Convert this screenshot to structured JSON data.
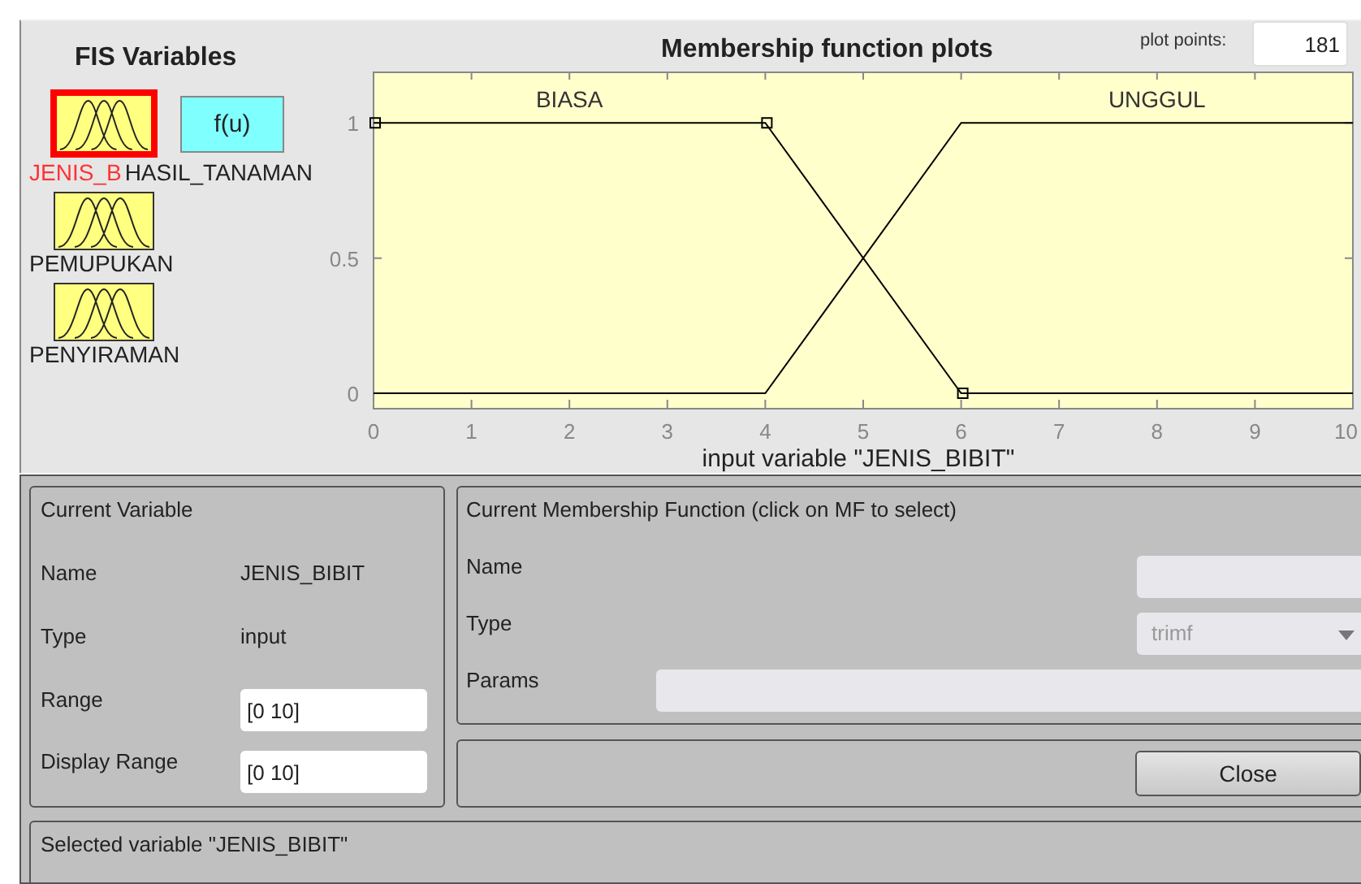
{
  "fis_variables": {
    "title": "FIS Variables",
    "items": [
      {
        "name": "JENIS_B",
        "kind": "input",
        "selected": true
      },
      {
        "name": "HASIL_TANAMAN",
        "kind": "output",
        "symbol": "f(u)",
        "selected": false
      },
      {
        "name": "PEMUPUKAN",
        "kind": "input",
        "selected": false
      },
      {
        "name": "PENYIRAMAN",
        "kind": "input",
        "selected": false
      }
    ]
  },
  "plot": {
    "title": "Membership function plots",
    "plot_points_label": "plot points:",
    "plot_points": "181",
    "chart_data": {
      "type": "line",
      "xlabel": "input variable \"JENIS_BIBIT\"",
      "x": [
        0,
        4,
        6,
        10
      ],
      "series": [
        {
          "name": "BIASA",
          "color": "#000000",
          "values": [
            1,
            1,
            0,
            0
          ]
        },
        {
          "name": "UNGGUL",
          "color": "#000000",
          "values": [
            0,
            0,
            1,
            1
          ]
        }
      ],
      "xlim": [
        0,
        10
      ],
      "ylim": [
        -0.054,
        1.19
      ],
      "xticks": [
        0,
        1,
        2,
        3,
        4,
        5,
        6,
        7,
        8,
        9,
        10
      ],
      "yticks": [
        0,
        {
          "value": 0.5,
          "label": "0.5"
        },
        1
      ]
    }
  },
  "current_variable": {
    "title": "Current Variable",
    "name_label": "Name",
    "name": "JENIS_BIBIT",
    "type_label": "Type",
    "type": "input",
    "range_label": "Range",
    "range": "[0 10]",
    "display_range_label": "Display Range",
    "display_range": "[0 10]"
  },
  "current_mf": {
    "title": "Current Membership Function (click on MF to select)",
    "name_label": "Name",
    "type_label": "Type",
    "type": "trimf",
    "params_label": "Params",
    "disabled": true
  },
  "close_button": "Close",
  "status": "Selected variable \"JENIS_BIBIT\""
}
